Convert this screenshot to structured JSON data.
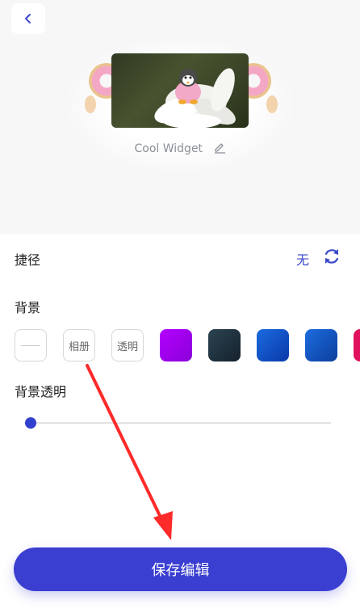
{
  "header": {
    "back_icon": "chevron-left-icon"
  },
  "widget": {
    "name": "Cool Widget",
    "edit_icon": "pencil-icon"
  },
  "shortcut": {
    "label": "捷径",
    "value": "无",
    "refresh_icon": "refresh-icon"
  },
  "background": {
    "label": "背景",
    "options": [
      {
        "type": "none",
        "label": ""
      },
      {
        "type": "album",
        "label": "相册"
      },
      {
        "type": "transparent",
        "label": "透明"
      },
      {
        "type": "color",
        "color": "#a000f0"
      },
      {
        "type": "color",
        "color": "#1e2f3c"
      },
      {
        "type": "color",
        "color": "#0c4fc4"
      },
      {
        "type": "color",
        "color": "#0d56c8"
      },
      {
        "type": "color",
        "color": "#e0125d"
      }
    ]
  },
  "opacity": {
    "label": "背景透明",
    "value": 0
  },
  "footer": {
    "save_label": "保存编辑"
  },
  "colors": {
    "accent": "#3a3ed1",
    "arrow": "#ff2a2a"
  }
}
